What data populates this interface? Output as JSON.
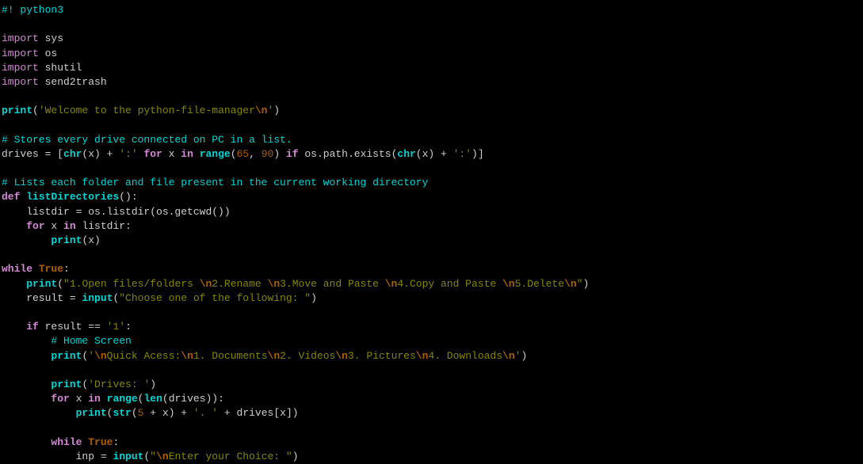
{
  "lines": {
    "l1_shebang": "#! python3",
    "l3_import": "import",
    "l3_mod": " sys",
    "l4_import": "import",
    "l4_mod": " os",
    "l5_import": "import",
    "l5_mod": " shutil",
    "l6_import": "import",
    "l6_mod": " send2trash",
    "l8_print": "print",
    "l8_paren1": "(",
    "l8_str1": "'Welcome to the python-file-manager",
    "l8_esc": "\\n",
    "l8_str2": "'",
    "l8_paren2": ")",
    "l10_comment": "# Stores every drive connected on PC in a list.",
    "l11_var": "drives = [",
    "l11_chr": "chr",
    "l11_p1": "(x) + ",
    "l11_s1": "':'",
    "l11_for": " for",
    "l11_p2": " x ",
    "l11_in": "in",
    "l11_sp": " ",
    "l11_range": "range",
    "l11_p3": "(",
    "l11_n1": "65",
    "l11_c1": ", ",
    "l11_n2": "90",
    "l11_p4": ") ",
    "l11_if": "if",
    "l11_p5": " os.path.exists(",
    "l11_chr2": "chr",
    "l11_p6": "(x) + ",
    "l11_s2": "':'",
    "l11_p7": ")]",
    "l13_comment": "# Lists each folder and file present in the current working directory",
    "l14_def": "def",
    "l14_sp": " ",
    "l14_fn": "listDirectories",
    "l14_p": "():",
    "l15": "    listdir = os.listdir(os.getcwd())",
    "l16_ind": "    ",
    "l16_for": "for",
    "l16_p1": " x ",
    "l16_in": "in",
    "l16_p2": " listdir:",
    "l17_ind": "        ",
    "l17_print": "print",
    "l17_p": "(x)",
    "l19_while": "while",
    "l19_sp": " ",
    "l19_true": "True",
    "l19_c": ":",
    "l20_ind": "    ",
    "l20_print": "print",
    "l20_p1": "(",
    "l20_s1": "\"1.Open files/folders ",
    "l20_e1": "\\n",
    "l20_s2": "2.Rename ",
    "l20_e2": "\\n",
    "l20_s3": "3.Move and Paste ",
    "l20_e3": "\\n",
    "l20_s4": "4.Copy and Paste ",
    "l20_e4": "\\n",
    "l20_s5": "5.Delete",
    "l20_e5": "\\n",
    "l20_s6": "\"",
    "l20_p2": ")",
    "l21_ind": "    result = ",
    "l21_input": "input",
    "l21_p1": "(",
    "l21_s": "\"Choose one of the following: \"",
    "l21_p2": ")",
    "l23_ind": "    ",
    "l23_if": "if",
    "l23_p1": " result == ",
    "l23_s": "'1'",
    "l23_c": ":",
    "l24_comment": "        # Home Screen",
    "l25_ind": "        ",
    "l25_print": "print",
    "l25_p1": "(",
    "l25_s1": "'",
    "l25_e1": "\\n",
    "l25_s2": "Quick Acess:",
    "l25_e2": "\\n",
    "l25_s3": "1. Documents",
    "l25_e3": "\\n",
    "l25_s4": "2. Videos",
    "l25_e4": "\\n",
    "l25_s5": "3. Pictures",
    "l25_e5": "\\n",
    "l25_s6": "4. Downloads",
    "l25_e6": "\\n",
    "l25_s7": "'",
    "l25_p2": ")",
    "l27_ind": "        ",
    "l27_print": "print",
    "l27_p1": "(",
    "l27_s": "'Drives: '",
    "l27_p2": ")",
    "l28_ind": "        ",
    "l28_for": "for",
    "l28_p1": " x ",
    "l28_in": "in",
    "l28_sp": " ",
    "l28_range": "range",
    "l28_p2": "(",
    "l28_len": "len",
    "l28_p3": "(drives)):",
    "l29_ind": "            ",
    "l29_print": "print",
    "l29_p1": "(",
    "l29_str": "str",
    "l29_p2": "(",
    "l29_n": "5",
    "l29_p3": " + x) + ",
    "l29_s": "'. '",
    "l29_p4": " + drives[x])",
    "l31_ind": "        ",
    "l31_while": "while",
    "l31_sp": " ",
    "l31_true": "True",
    "l31_c": ":",
    "l32_ind": "            inp = ",
    "l32_input": "input",
    "l32_p1": "(",
    "l32_s1": "\"",
    "l32_e1": "\\n",
    "l32_s2": "Enter your Choice: \"",
    "l32_p2": ")"
  }
}
